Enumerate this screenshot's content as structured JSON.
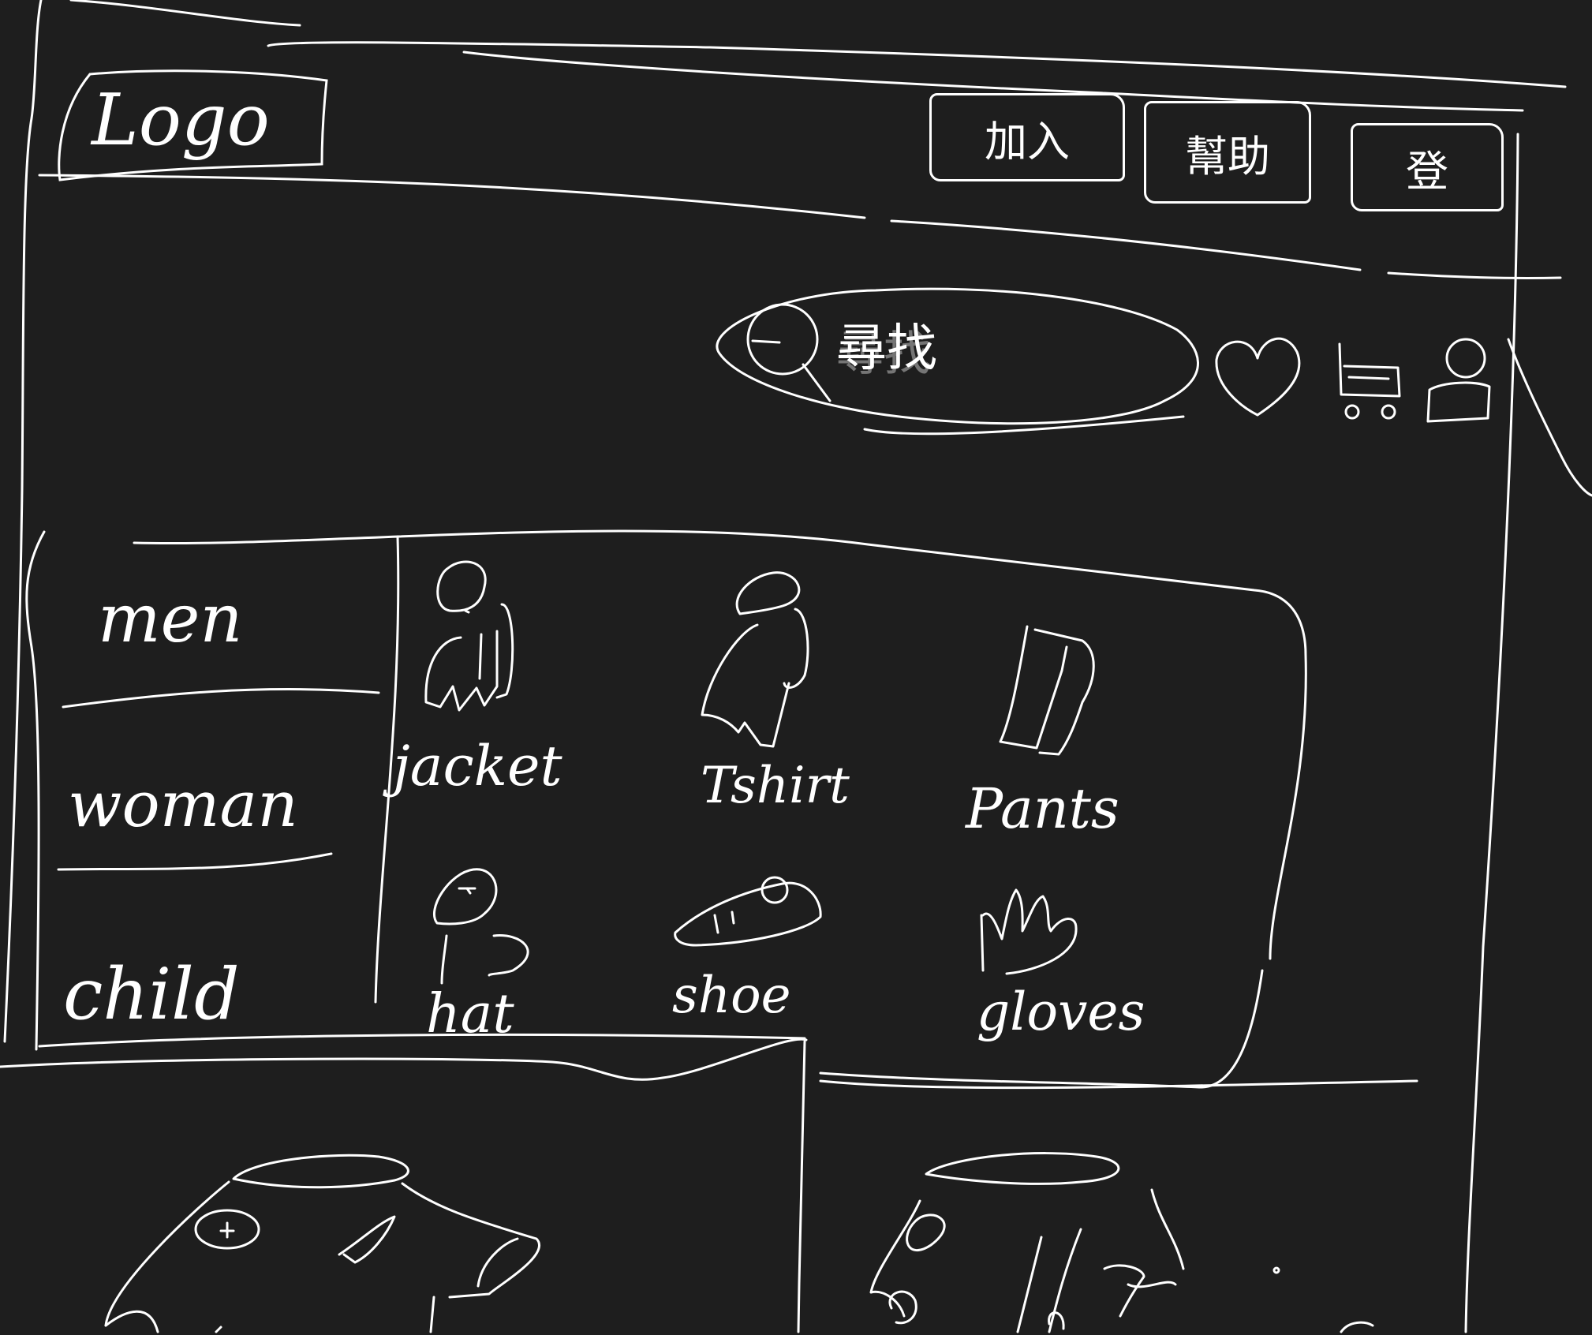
{
  "header": {
    "logo_text": "Logo",
    "nav": [
      {
        "label": "加入"
      },
      {
        "label": "幫助"
      },
      {
        "label": "登"
      }
    ]
  },
  "search": {
    "placeholder": "尋找"
  },
  "icons": {
    "search": "search-icon",
    "favorites": "heart-icon",
    "cart": "cart-icon",
    "account": "user-icon"
  },
  "sidebar": {
    "items": [
      {
        "label": "men"
      },
      {
        "label": "woman"
      },
      {
        "label": "child"
      }
    ]
  },
  "categories": [
    {
      "label": "jacket",
      "icon": "jacket-icon"
    },
    {
      "label": "Tshirt",
      "icon": "tshirt-icon"
    },
    {
      "label": "Pants",
      "icon": "pants-icon"
    },
    {
      "label": "hat",
      "icon": "hat-icon"
    },
    {
      "label": "shoe",
      "icon": "shoe-icon"
    },
    {
      "label": "gloves",
      "icon": "gloves-icon"
    }
  ],
  "products": [
    {
      "icon": "tshirt-product-image"
    },
    {
      "icon": "pants-product-image"
    }
  ],
  "colors": {
    "background": "#1e1e1e",
    "stroke": "#ffffff"
  }
}
